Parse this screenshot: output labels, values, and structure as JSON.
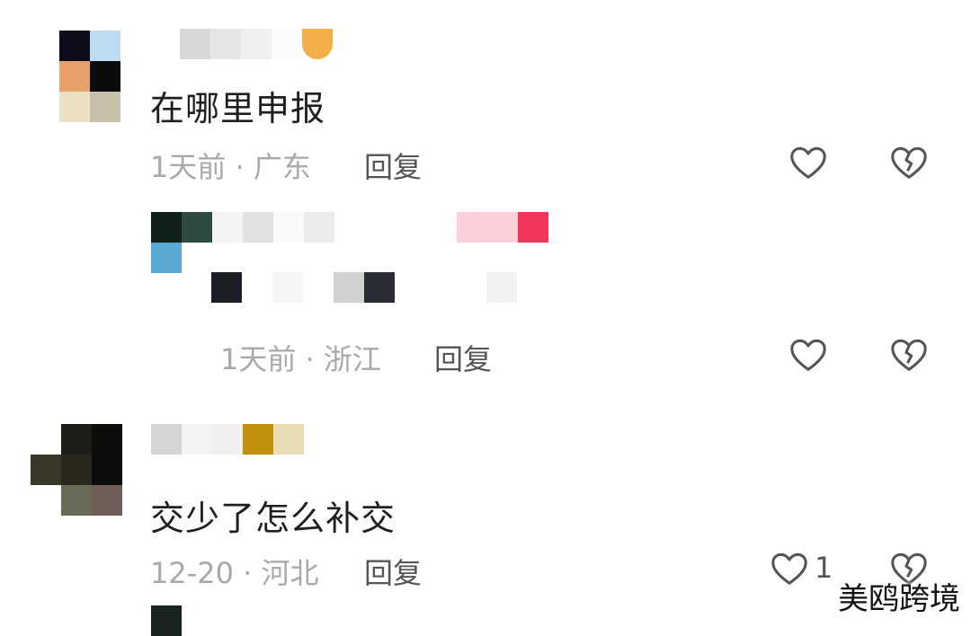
{
  "comments": [
    {
      "text": "在哪里申报",
      "time": "1天前",
      "location": "广东",
      "reply_label": "回复"
    },
    {
      "time": "1天前",
      "location": "浙江",
      "reply_label": "回复"
    },
    {
      "text": "交少了怎么补交",
      "time": "12-20",
      "location": "河北",
      "reply_label": "回复",
      "like_count": "1"
    }
  ],
  "meta_separator": "·",
  "watermark": "美鸥跨境",
  "icons": {
    "like": "heart-outline-icon",
    "dislike": "broken-heart-icon"
  },
  "colors": {
    "text": "#1f1f1f",
    "meta": "#a9a9a9",
    "reply": "#555555",
    "icon": "#555555"
  }
}
